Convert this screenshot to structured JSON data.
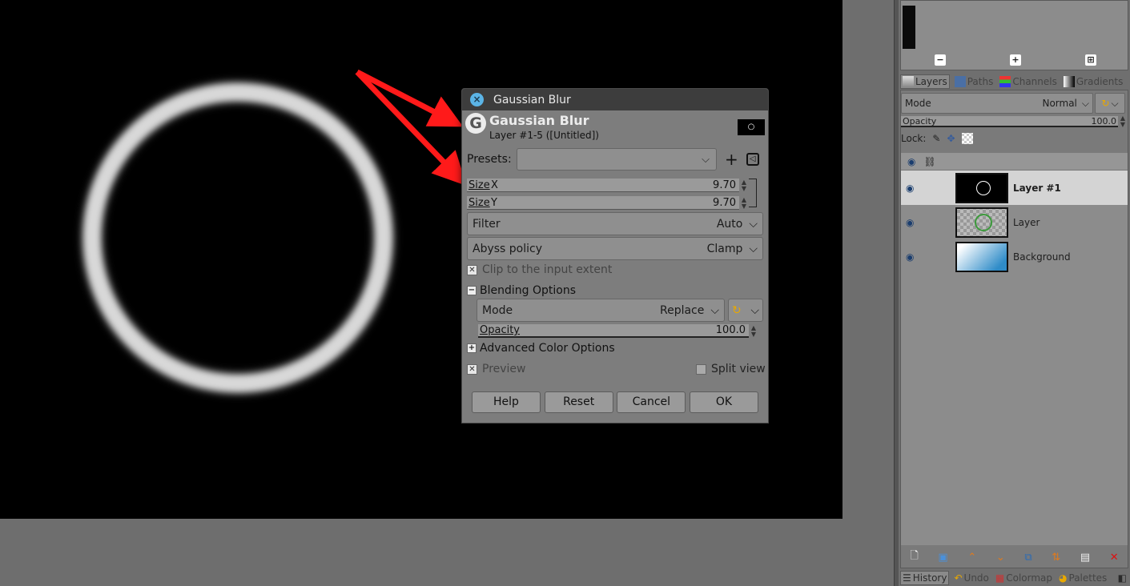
{
  "dialog": {
    "window_title": "Gaussian Blur",
    "header_title": "Gaussian Blur",
    "header_subtitle": "Layer #1-5 ([Untitled])",
    "presets_label": "Presets:",
    "size_x": {
      "label": "Size",
      "axis": "X",
      "value": "9.70"
    },
    "size_y": {
      "label": "Size",
      "axis": "Y",
      "value": "9.70"
    },
    "filter": {
      "label": "Filter",
      "value": "Auto"
    },
    "abyss": {
      "label": "Abyss policy",
      "value": "Clamp"
    },
    "clip_label": "Clip to the input extent",
    "blending_label": "Blending Options",
    "mode": {
      "label": "Mode",
      "value": "Replace"
    },
    "opacity": {
      "label": "Opacity",
      "value": "100.0"
    },
    "advanced_label": "Advanced Color Options",
    "preview_label": "Preview",
    "split_view_label": "Split view",
    "buttons": {
      "help": "Help",
      "reset": "Reset",
      "cancel": "Cancel",
      "ok": "OK"
    }
  },
  "dock": {
    "tabs": {
      "layers": "Layers",
      "paths": "Paths",
      "channels": "Channels",
      "gradients": "Gradients"
    },
    "mode_label": "Mode",
    "mode_value": "Normal",
    "opacity_label": "Opacity",
    "opacity_value": "100.0",
    "lock_label": "Lock:",
    "layers": [
      {
        "name": "Layer #1"
      },
      {
        "name": "Layer"
      },
      {
        "name": "Background"
      }
    ],
    "bottom_tabs": {
      "history": "History",
      "undo": "Undo",
      "colormap": "Colormap",
      "palettes": "Palettes"
    }
  },
  "colors": {
    "arrow": "#ff1a1a",
    "canvas": "#000000",
    "ring": "#d8d8d8",
    "close_button": "#5bb4e6"
  }
}
